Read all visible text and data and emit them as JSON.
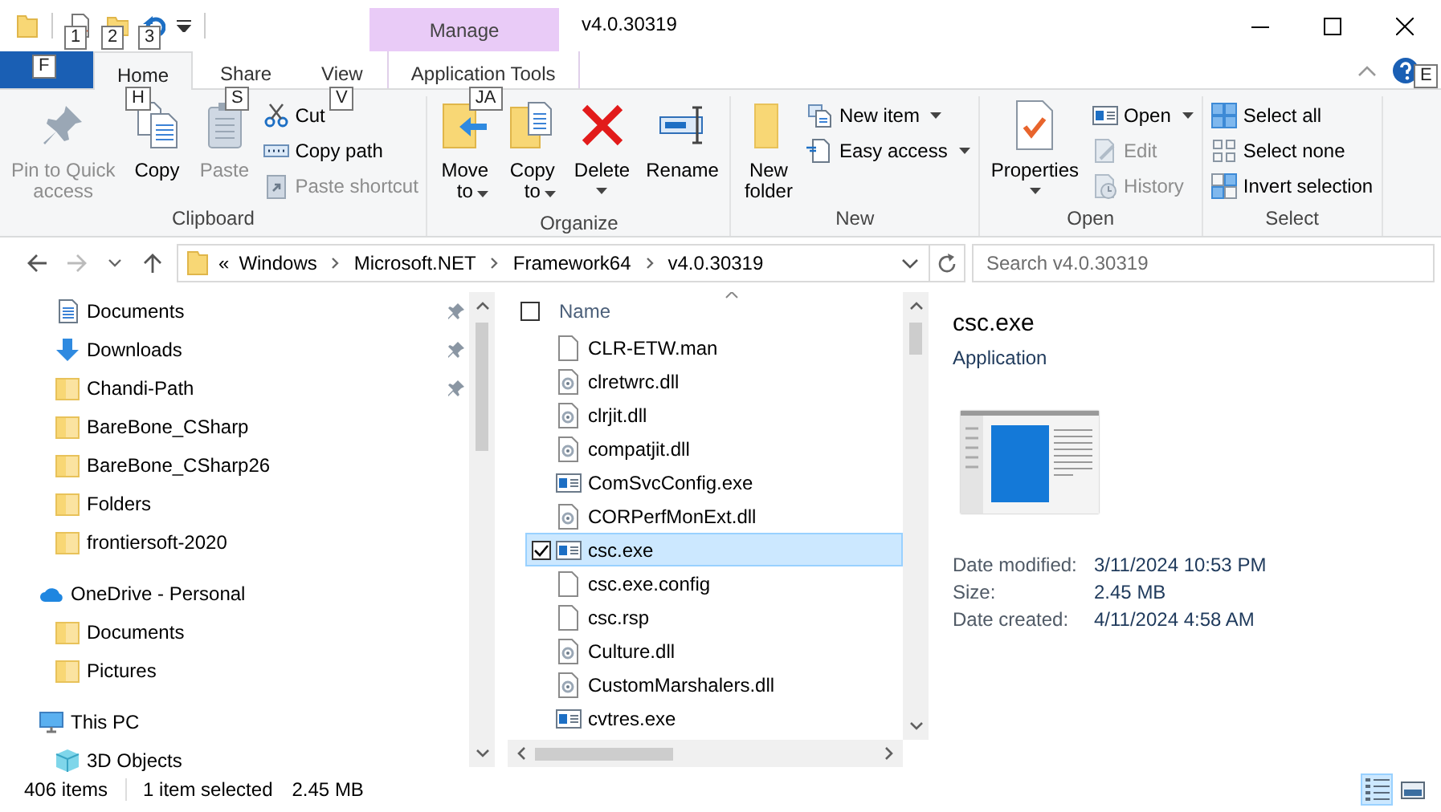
{
  "quick_access_toolbar": {
    "keytips": [
      "1",
      "2",
      "3"
    ]
  },
  "contextual_tab": {
    "label": "Manage"
  },
  "window": {
    "title": "v4.0.30319"
  },
  "file_tab": {
    "keytip": "F"
  },
  "tabs": [
    {
      "label": "Home",
      "keytip": "H",
      "selected": true
    },
    {
      "label": "Share",
      "keytip": "S",
      "selected": false
    },
    {
      "label": "View",
      "keytip": "V",
      "selected": false
    },
    {
      "label": "Application Tools",
      "keytip": "JA",
      "selected": false
    }
  ],
  "help_keytip": "E",
  "ribbon_groups": [
    {
      "label": "Clipboard",
      "buttons": [
        {
          "kind": "large",
          "lines": [
            "Pin to Quick",
            "access"
          ],
          "disabled": true,
          "dropdown": false
        },
        {
          "kind": "large",
          "lines": [
            "Copy"
          ],
          "disabled": false,
          "dropdown": false
        },
        {
          "kind": "large",
          "lines": [
            "Paste"
          ],
          "disabled": true,
          "dropdown": false
        },
        {
          "kind": "small",
          "lines": [
            "Cut"
          ],
          "disabled": false,
          "dropdown": false
        },
        {
          "kind": "small",
          "lines": [
            "Copy path"
          ],
          "disabled": false,
          "dropdown": false
        },
        {
          "kind": "small",
          "lines": [
            "Paste shortcut"
          ],
          "disabled": true,
          "dropdown": false
        }
      ]
    },
    {
      "label": "Organize",
      "buttons": [
        {
          "kind": "large",
          "lines": [
            "Move",
            "to"
          ],
          "disabled": false,
          "dropdown": true
        },
        {
          "kind": "large",
          "lines": [
            "Copy",
            "to"
          ],
          "disabled": false,
          "dropdown": true
        },
        {
          "kind": "large",
          "lines": [
            "Delete"
          ],
          "disabled": false,
          "dropdown": true
        },
        {
          "kind": "large",
          "lines": [
            "Rename"
          ],
          "disabled": false,
          "dropdown": false
        }
      ]
    },
    {
      "label": "New",
      "buttons": [
        {
          "kind": "large",
          "lines": [
            "New",
            "folder"
          ],
          "disabled": false,
          "dropdown": false
        },
        {
          "kind": "small",
          "lines": [
            "New item"
          ],
          "disabled": false,
          "dropdown": true
        },
        {
          "kind": "small",
          "lines": [
            "Easy access"
          ],
          "disabled": false,
          "dropdown": true
        }
      ]
    },
    {
      "label": "Open",
      "buttons": [
        {
          "kind": "large",
          "lines": [
            "Properties"
          ],
          "disabled": false,
          "dropdown": true
        },
        {
          "kind": "small",
          "lines": [
            "Open"
          ],
          "disabled": false,
          "dropdown": true
        },
        {
          "kind": "small",
          "lines": [
            "Edit"
          ],
          "disabled": true,
          "dropdown": false
        },
        {
          "kind": "small",
          "lines": [
            "History"
          ],
          "disabled": true,
          "dropdown": false
        }
      ]
    },
    {
      "label": "Select",
      "buttons": [
        {
          "kind": "small",
          "lines": [
            "Select all"
          ],
          "disabled": false,
          "dropdown": false
        },
        {
          "kind": "small",
          "lines": [
            "Select none"
          ],
          "disabled": false,
          "dropdown": false
        },
        {
          "kind": "small",
          "lines": [
            "Invert selection"
          ],
          "disabled": false,
          "dropdown": false
        }
      ]
    }
  ],
  "address_bar": {
    "overflow": "«",
    "segments": [
      "Windows",
      "Microsoft.NET",
      "Framework64",
      "v4.0.30319"
    ]
  },
  "search": {
    "placeholder": "Search v4.0.30319"
  },
  "quick_access_items": [
    {
      "label": "Documents",
      "kind": "documents",
      "pinned": true
    },
    {
      "label": "Downloads",
      "kind": "downloads",
      "pinned": true
    },
    {
      "label": "Chandi-Path",
      "kind": "folder",
      "pinned": true
    },
    {
      "label": "BareBone_CSharp",
      "kind": "folder",
      "pinned": false
    },
    {
      "label": "BareBone_CSharp26",
      "kind": "folder",
      "pinned": false
    },
    {
      "label": "Folders",
      "kind": "folder",
      "pinned": false
    },
    {
      "label": "frontiersoft-2020",
      "kind": "folder",
      "pinned": false
    }
  ],
  "nav_tree": [
    {
      "label": "OneDrive - Personal",
      "kind": "cloud",
      "children": [
        {
          "label": "Documents",
          "kind": "folder"
        },
        {
          "label": "Pictures",
          "kind": "folder"
        }
      ]
    },
    {
      "label": "This PC",
      "kind": "pc",
      "children": [
        {
          "label": "3D Objects",
          "kind": "cube"
        }
      ]
    }
  ],
  "file_list": {
    "column": "Name",
    "all_checked": false,
    "rows": [
      {
        "name": "CLR-ETW.man",
        "kind": "file",
        "selected": false,
        "checked": false
      },
      {
        "name": "clretwrc.dll",
        "kind": "dll",
        "selected": false,
        "checked": false
      },
      {
        "name": "clrjit.dll",
        "kind": "dll",
        "selected": false,
        "checked": false
      },
      {
        "name": "compatjit.dll",
        "kind": "dll",
        "selected": false,
        "checked": false
      },
      {
        "name": "ComSvcConfig.exe",
        "kind": "exe",
        "selected": false,
        "checked": false
      },
      {
        "name": "CORPerfMonExt.dll",
        "kind": "dll",
        "selected": false,
        "checked": false
      },
      {
        "name": "csc.exe",
        "kind": "exe",
        "selected": true,
        "checked": true
      },
      {
        "name": "csc.exe.config",
        "kind": "file",
        "selected": false,
        "checked": false
      },
      {
        "name": "csc.rsp",
        "kind": "file",
        "selected": false,
        "checked": false
      },
      {
        "name": "Culture.dll",
        "kind": "dll",
        "selected": false,
        "checked": false
      },
      {
        "name": "CustomMarshalers.dll",
        "kind": "dll",
        "selected": false,
        "checked": false
      },
      {
        "name": "cvtres.exe",
        "kind": "exe",
        "selected": false,
        "checked": false
      }
    ]
  },
  "details_pane": {
    "name": "csc.exe",
    "type": "Application",
    "properties": [
      {
        "label": "Date modified:",
        "value": "3/11/2024 10:53 PM"
      },
      {
        "label": "Size:",
        "value": "2.45 MB"
      },
      {
        "label": "Date created:",
        "value": "4/11/2024 4:58 AM"
      }
    ]
  },
  "status_bar": {
    "item_count": "406 items",
    "selection": "1 item selected",
    "size": "2.45 MB"
  },
  "view_buttons": [
    {
      "selected": true
    },
    {
      "selected": false
    }
  ]
}
